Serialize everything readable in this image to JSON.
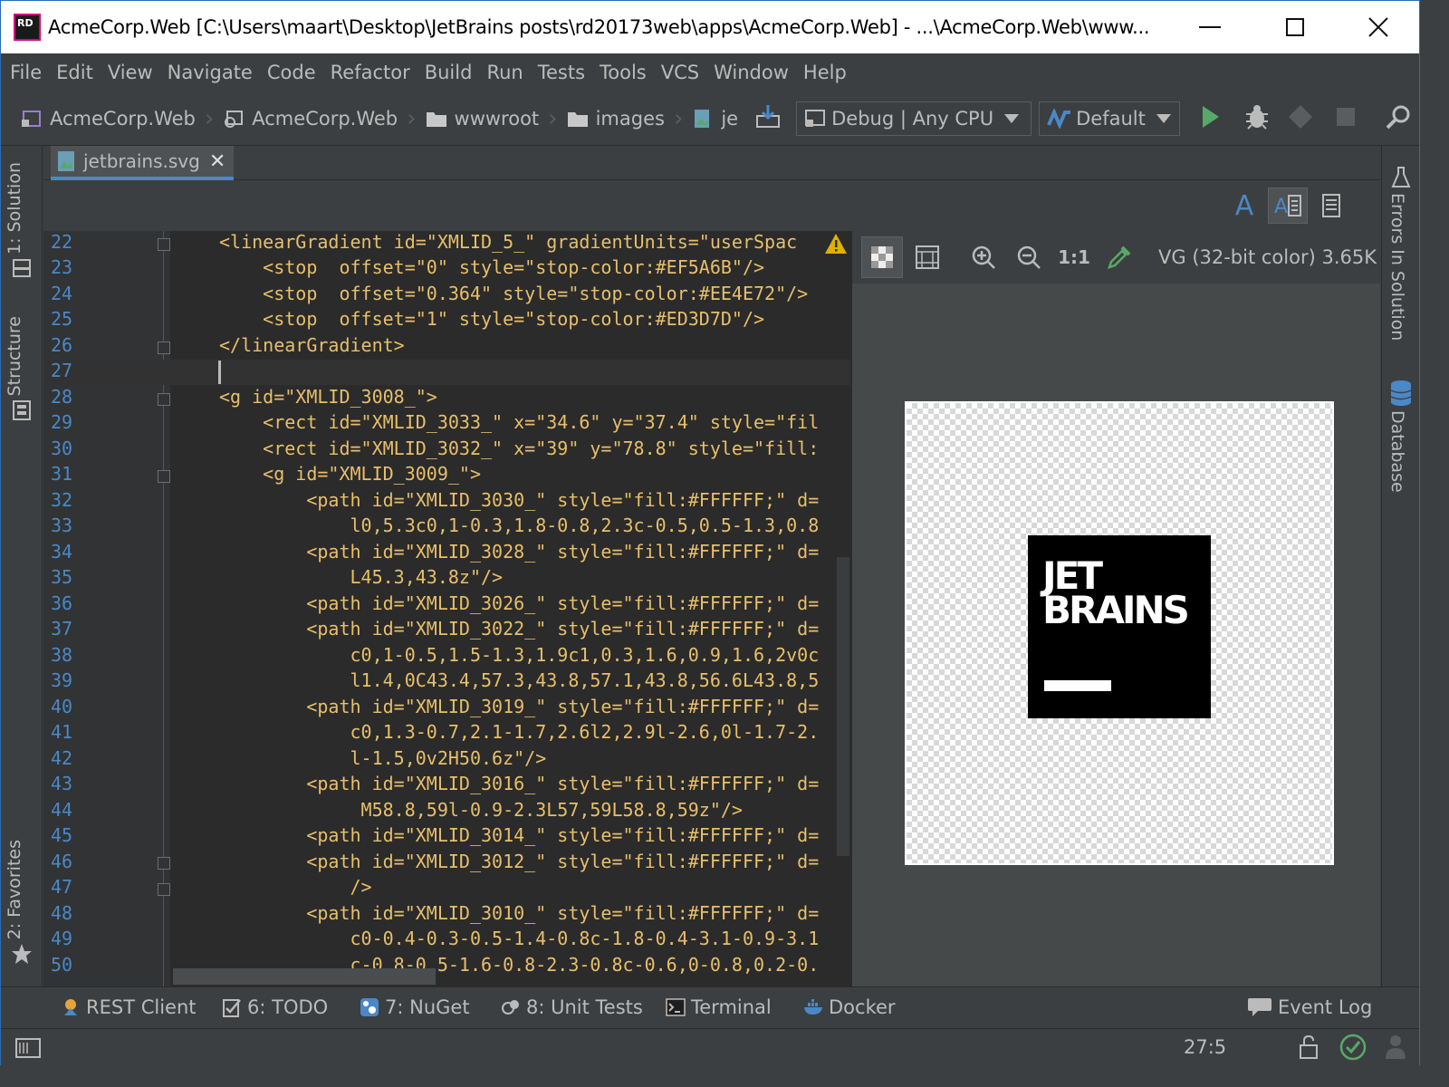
{
  "window": {
    "title": "AcmeCorp.Web [C:\\Users\\maart\\Desktop\\JetBrains posts\\rd20173web\\apps\\AcmeCorp.Web] - ...\\AcmeCorp.Web\\www...",
    "app_icon_text": "RD"
  },
  "menu": [
    "File",
    "Edit",
    "View",
    "Navigate",
    "Code",
    "Refactor",
    "Build",
    "Run",
    "Tests",
    "Tools",
    "VCS",
    "Window",
    "Help"
  ],
  "navbar": {
    "breadcrumbs": [
      "AcmeCorp.Web",
      "AcmeCorp.Web",
      "wwwroot",
      "images",
      "je"
    ],
    "run_config": "Debug | Any CPU",
    "target": "Default"
  },
  "left_tabs": {
    "solution": "1: Solution",
    "structure": "Structure",
    "favorites": "2: Favorites"
  },
  "right_tabs": {
    "errors": "Errors In Solution",
    "database": "Database"
  },
  "editor": {
    "tab_label": "jetbrains.svg",
    "cursor_line": 27,
    "lines": [
      {
        "n": "22",
        "text": "<linearGradient id=\"XMLID_5_\" gradientUnits=\"userSpac"
      },
      {
        "n": "23",
        "text": "    <stop  offset=\"0\" style=\"stop-color:#EF5A6B\"/>"
      },
      {
        "n": "24",
        "text": "    <stop  offset=\"0.364\" style=\"stop-color:#EE4E72\"/>"
      },
      {
        "n": "25",
        "text": "    <stop  offset=\"1\" style=\"stop-color:#ED3D7D\"/>"
      },
      {
        "n": "26",
        "text": "</linearGradient>"
      },
      {
        "n": "27",
        "text": ""
      },
      {
        "n": "28",
        "text": "<g id=\"XMLID_3008_\">"
      },
      {
        "n": "29",
        "text": "    <rect id=\"XMLID_3033_\" x=\"34.6\" y=\"37.4\" style=\"fil"
      },
      {
        "n": "30",
        "text": "    <rect id=\"XMLID_3032_\" x=\"39\" y=\"78.8\" style=\"fill:"
      },
      {
        "n": "31",
        "text": "    <g id=\"XMLID_3009_\">"
      },
      {
        "n": "32",
        "text": "        <path id=\"XMLID_3030_\" style=\"fill:#FFFFFF;\" d="
      },
      {
        "n": "33",
        "text": "            l0,5.3c0,1-0.3,1.8-0.8,2.3c-0.5,0.5-1.3,0.8"
      },
      {
        "n": "34",
        "text": "        <path id=\"XMLID_3028_\" style=\"fill:#FFFFFF;\" d="
      },
      {
        "n": "35",
        "text": "            L45.3,43.8z\"/>"
      },
      {
        "n": "36",
        "text": "        <path id=\"XMLID_3026_\" style=\"fill:#FFFFFF;\" d="
      },
      {
        "n": "37",
        "text": "        <path id=\"XMLID_3022_\" style=\"fill:#FFFFFF;\" d="
      },
      {
        "n": "38",
        "text": "            c0,1-0.5,1.5-1.3,1.9c1,0.3,1.6,0.9,1.6,2v0c"
      },
      {
        "n": "39",
        "text": "            l1.4,0C43.4,57.3,43.8,57.1,43.8,56.6L43.8,5"
      },
      {
        "n": "40",
        "text": "        <path id=\"XMLID_3019_\" style=\"fill:#FFFFFF;\" d="
      },
      {
        "n": "41",
        "text": "            c0,1.3-0.7,2.1-1.7,2.6l2,2.9l-2.6,0l-1.7-2."
      },
      {
        "n": "42",
        "text": "            l-1.5,0v2H50.6z\"/>"
      },
      {
        "n": "43",
        "text": "        <path id=\"XMLID_3016_\" style=\"fill:#FFFFFF;\" d="
      },
      {
        "n": "44",
        "text": "             M58.8,59l-0.9-2.3L57,59L58.8,59z\"/>"
      },
      {
        "n": "45",
        "text": "        <path id=\"XMLID_3014_\" style=\"fill:#FFFFFF;\" d="
      },
      {
        "n": "46",
        "text": "        <path id=\"XMLID_3012_\" style=\"fill:#FFFFFF;\" d="
      },
      {
        "n": "47",
        "text": "            />"
      },
      {
        "n": "48",
        "text": "        <path id=\"XMLID_3010_\" style=\"fill:#FFFFFF;\" d="
      },
      {
        "n": "49",
        "text": "            c0-0.4-0.3-0.5-1.4-0.8c-1.8-0.4-3.1-0.9-3.1"
      },
      {
        "n": "50",
        "text": "            c-0.8-0.5-1.6-0.8-2.3-0.8c-0.6,0-0.8,0.2-0."
      }
    ]
  },
  "preview": {
    "info": "VG (32-bit color) 3.65K",
    "zoom_actual": "1:1",
    "logo_line1": "JET",
    "logo_line2": "BRAINS"
  },
  "bottom_tools": [
    "REST Client",
    "6: TODO",
    "7: NuGet",
    "8: Unit Tests",
    "Terminal",
    "Docker",
    "Event Log"
  ],
  "status": {
    "position": "27:5"
  },
  "colors": {
    "accent": "#4a88c7",
    "tag": "#e8bf6a",
    "line_number": "#4a88c7",
    "run": "#59a869"
  }
}
